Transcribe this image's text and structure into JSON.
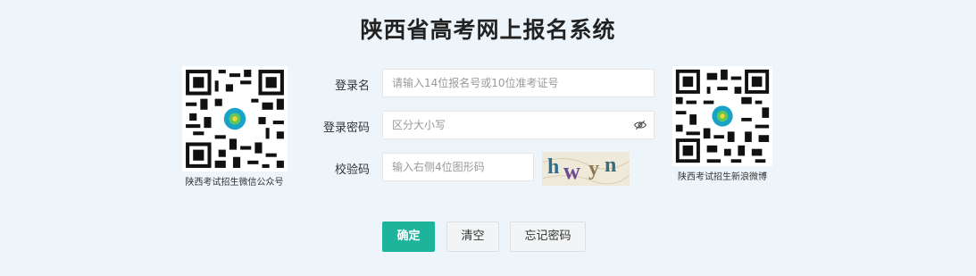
{
  "header": {
    "title": "陕西省高考网上报名系统"
  },
  "qr_left": {
    "caption": "陕西考试招生微信公众号"
  },
  "qr_right": {
    "caption": "陕西考试招生新浪微博"
  },
  "form": {
    "username": {
      "label": "登录名",
      "placeholder": "请输入14位报名号或10位准考证号"
    },
    "password": {
      "label": "登录密码",
      "placeholder": "区分大小写",
      "toggle_icon": "eye-icon"
    },
    "captcha": {
      "label": "校验码",
      "placeholder": "输入右侧4位图形码",
      "image_text": "hwyn"
    }
  },
  "buttons": {
    "confirm": "确定",
    "clear": "清空",
    "forgot": "忘记密码"
  },
  "colors": {
    "accent": "#1eb49c",
    "background": "#edf5fb"
  }
}
